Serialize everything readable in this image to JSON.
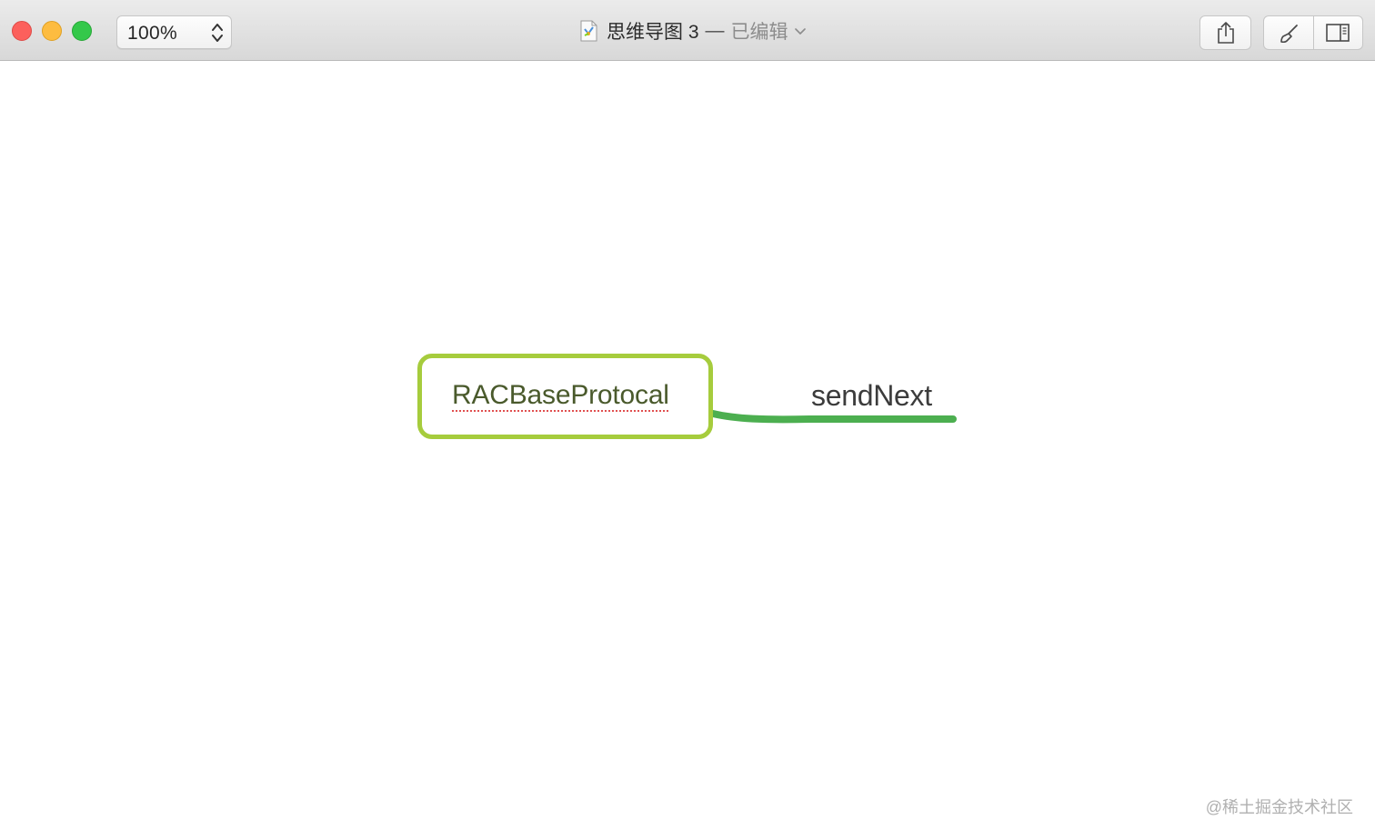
{
  "window": {
    "zoom": "100%",
    "document_title": "思维导图 3",
    "title_separator": "—",
    "edit_status": "已编辑"
  },
  "icons": {
    "close": "close-icon",
    "minimize": "minimize-icon",
    "zoom": "fullscreen-icon",
    "stepper": "up-down-chevron-icon",
    "document": "mindmap-document-icon",
    "title_menu": "chevron-down-icon",
    "share": "share-icon",
    "format": "brush-icon",
    "sidebar": "sidebar-toggle-icon"
  },
  "mindmap": {
    "central_topic": "RACBaseProtocal",
    "subtopics": [
      "sendNext"
    ]
  },
  "colors": {
    "topic_border": "#a6cc3d",
    "branch_line": "#4caf50",
    "close": "#fc605c",
    "minimize": "#fdbc40",
    "maximize": "#34c84a"
  },
  "watermark": "@稀土掘金技术社区"
}
